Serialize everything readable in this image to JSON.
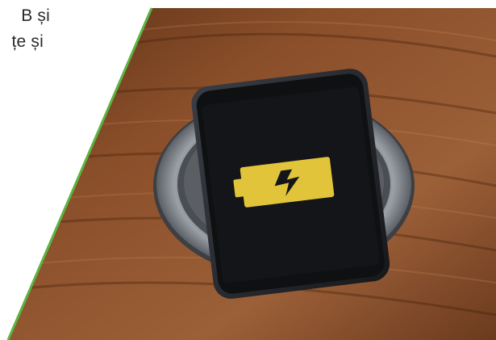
{
  "text": {
    "line1": "B și",
    "line2": "țe și"
  },
  "colors": {
    "accent_green": "#5cb443",
    "battery_yellow": "#e2c43a",
    "wood": "#8a4f2a"
  },
  "icons": {
    "battery": "battery-charging-icon"
  }
}
